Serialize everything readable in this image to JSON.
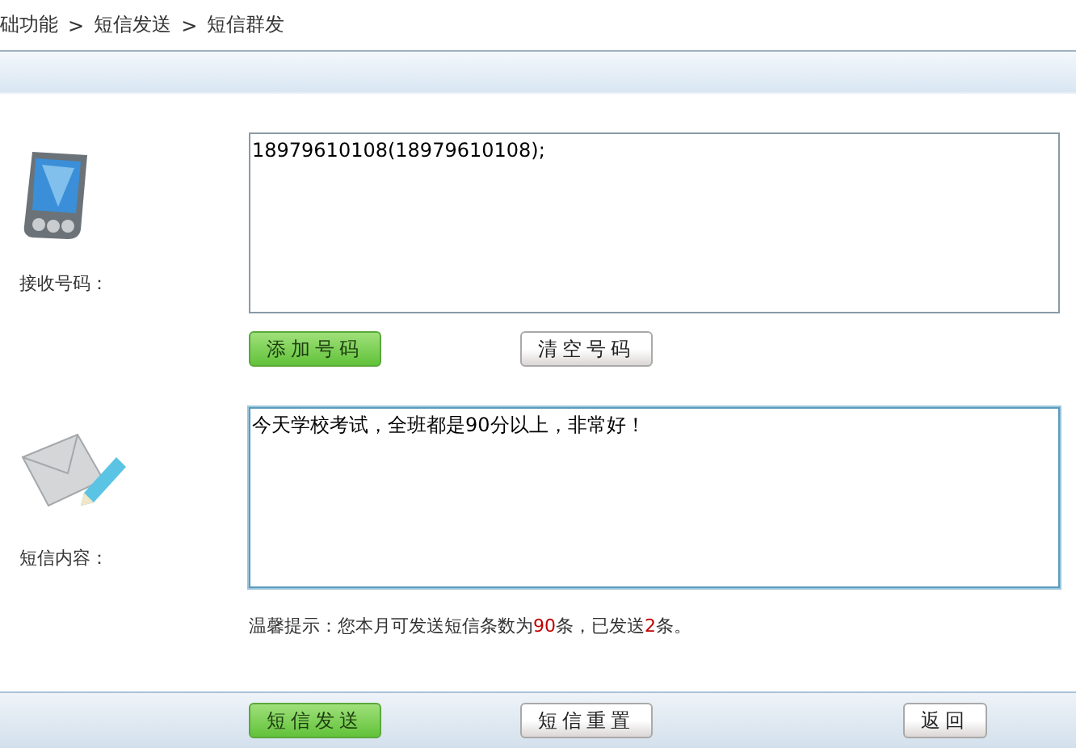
{
  "breadcrumb": [
    "础功能",
    "短信发送",
    "短信群发"
  ],
  "breadcrumb_separator": ">",
  "recipients": {
    "label": "接收号码：",
    "value": "18979610108(18979610108);",
    "focused": false,
    "buttons": [
      {
        "label": "添加号码",
        "kind": "primary"
      },
      {
        "label": "清空号码",
        "kind": "secondary"
      }
    ]
  },
  "message": {
    "label": "短信内容：",
    "value": "今天学校考试，全班都是90分以上，非常好！",
    "focused": true
  },
  "hint": [
    {
      "text": "温馨提示：您本月可发送短信条数为",
      "highlight": false
    },
    {
      "text": "90",
      "highlight": true
    },
    {
      "text": "条，已发送",
      "highlight": false
    },
    {
      "text": "2",
      "highlight": true
    },
    {
      "text": "条。",
      "highlight": false
    }
  ],
  "footer_buttons": [
    {
      "label": "短信发送",
      "kind": "primary"
    },
    {
      "label": "短信重置",
      "kind": "secondary"
    },
    {
      "label": "返回",
      "kind": "secondary"
    }
  ]
}
